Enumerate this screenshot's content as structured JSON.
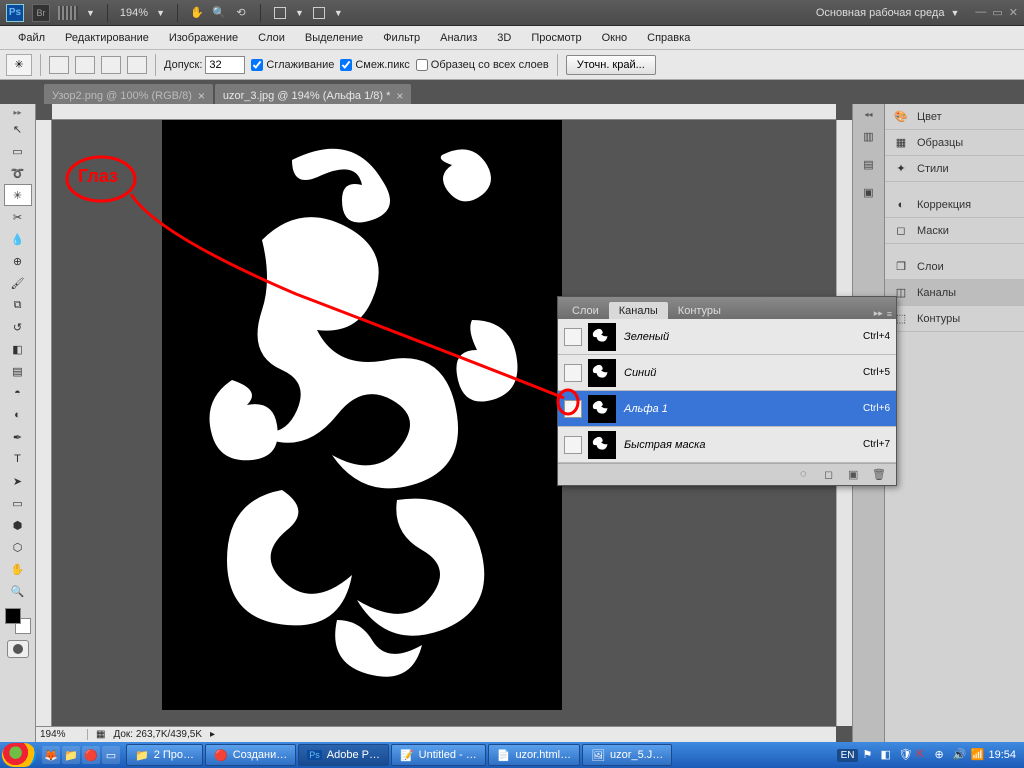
{
  "appbar": {
    "zoom": "194%",
    "workspace": "Основная рабочая среда"
  },
  "menu": [
    "Файл",
    "Редактирование",
    "Изображение",
    "Слои",
    "Выделение",
    "Фильтр",
    "Анализ",
    "3D",
    "Просмотр",
    "Окно",
    "Справка"
  ],
  "options": {
    "tolerance_label": "Допуск:",
    "tolerance_value": "32",
    "antialias": "Сглаживание",
    "contiguous": "Смеж.пикс",
    "sample_all": "Образец со всех слоев",
    "refine": "Уточн. край..."
  },
  "doc_tabs": [
    "Узор2.png @ 100% (RGB/8)",
    "uzor_3.jpg @ 194% (Альфа 1/8) *"
  ],
  "status": {
    "zoom": "194%",
    "doc_info": "Док: 263,7K/439,5K"
  },
  "right_panels": [
    "Цвет",
    "Образцы",
    "Стили",
    "Коррекция",
    "Маски",
    "Слои",
    "Каналы",
    "Контуры"
  ],
  "right_active_index": 6,
  "channels_panel": {
    "tabs": [
      "Слои",
      "Каналы",
      "Контуры"
    ],
    "active_tab": 1,
    "rows": [
      {
        "name": "Зеленый",
        "shortcut": "Ctrl+4",
        "visible": false
      },
      {
        "name": "Синий",
        "shortcut": "Ctrl+5",
        "visible": false
      },
      {
        "name": "Альфа 1",
        "shortcut": "Ctrl+6",
        "visible": true,
        "selected": true
      },
      {
        "name": "Быстрая маска",
        "shortcut": "Ctrl+7",
        "visible": false
      }
    ]
  },
  "annotation_label": "Глаз",
  "taskbar": {
    "tasks": [
      "2 Про…",
      "Создани…",
      "Adobe P…",
      "Untitled - …",
      "uzor.html…",
      "uzor_5.J…"
    ],
    "lang": "EN",
    "clock": "19:54"
  }
}
